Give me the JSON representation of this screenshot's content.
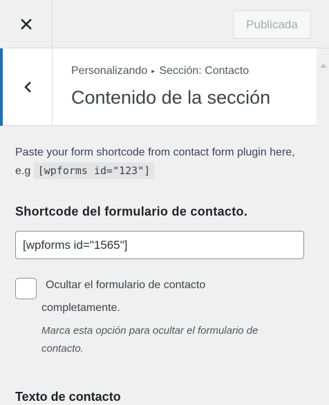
{
  "header": {
    "close_icon": "close-icon",
    "publish_label": "Publicada"
  },
  "section": {
    "back_icon": "chevron-left-icon",
    "breadcrumb_parent": "Personalizando",
    "breadcrumb_child": "Sección: Contacto",
    "title": "Contenido de la sección"
  },
  "content": {
    "description_text": "Paste your form shortcode from contact form plugin here, e.g",
    "description_code": "[wpforms id=\"123\"]",
    "shortcode_label": "Shortcode del formulario de contacto.",
    "shortcode_value": "[wpforms id=\"1565\"]",
    "hide_form_label_line1": "Ocultar el formulario de contacto",
    "hide_form_label_line2": "completamente.",
    "hide_form_checked": false,
    "hide_form_description": "Marca esta opción para ocultar el formulario de contacto.",
    "contact_text_label": "Texto de contacto"
  },
  "colors": {
    "accent": "#2271b1",
    "panel_bg": "#f0f0f1",
    "header_bg": "#ffffff"
  }
}
